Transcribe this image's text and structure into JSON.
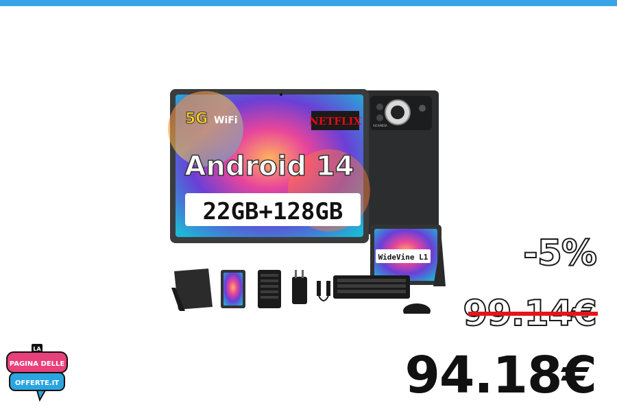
{
  "product": {
    "badge_5g": "5G",
    "badge_wifi": "WiFi",
    "netflix": "NETFLIX",
    "os": "Android 14",
    "memory": "22GB+128GB",
    "widevine": "WideVine L1",
    "camera_label": "AICAMERA"
  },
  "pricing": {
    "discount": "-5%",
    "old_price": "99.14€",
    "new_price": "94.18€"
  },
  "logo": {
    "line1": "LA",
    "line2": "PAGINA DELLE",
    "line3": "OFFERTE.IT"
  },
  "colors": {
    "top_bar": "#3aa3e8",
    "strike": "#e5141b",
    "logo_pink": "#e8407a",
    "logo_blue": "#2aa5e0"
  }
}
